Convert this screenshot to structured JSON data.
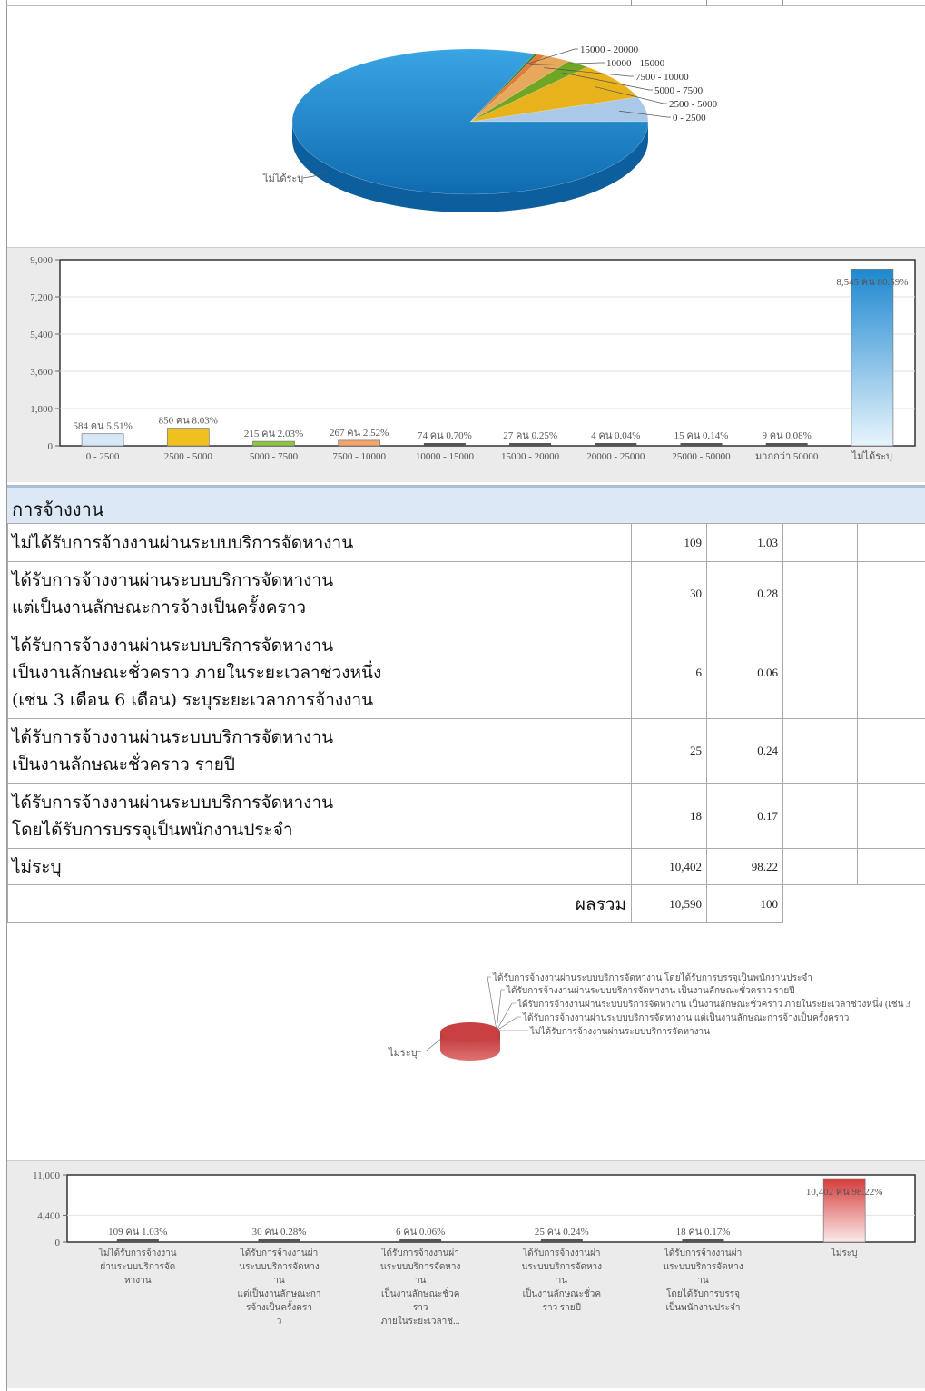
{
  "income_section": {
    "chart_data": [
      {
        "type": "pie",
        "labels": [
          "15000 - 20000",
          "10000 - 15000",
          "7500 - 10000",
          "5000 - 7500",
          "2500 - 5000",
          "0 - 2500",
          "ไม่ได้ระบุ"
        ],
        "values": [
          0.25,
          0.7,
          2.52,
          2.03,
          8.03,
          5.51,
          80.59
        ],
        "colors": [
          "#4f7a28",
          "#e07b39",
          "#e8a85b",
          "#6fa623",
          "#e7b21b",
          "#aac8e8",
          "#2a8fd0"
        ]
      },
      {
        "type": "bar",
        "categories": [
          "0 - 2500",
          "2500 - 5000",
          "5000 - 7500",
          "7500 - 10000",
          "10000 - 15000",
          "15000 - 20000",
          "20000 - 25000",
          "25000 - 50000",
          "มากกว่า 50000",
          "ไม่ได้ระบุ"
        ],
        "values": [
          584,
          850,
          215,
          267,
          74,
          27,
          4,
          15,
          9,
          8545
        ],
        "data_labels": [
          "584 คน 5.51%",
          "850 คน 8.03%",
          "215 คน 2.03%",
          "267 คน 2.52%",
          "74 คน 0.70%",
          "27 คน 0.25%",
          "4 คน 0.04%",
          "15 คน 0.14%",
          "9 คน 0.08%",
          "8,545 คน 80.59%"
        ],
        "colors": [
          "#d6e8f8",
          "#f0c020",
          "#8cc63f",
          "#f4a46a",
          "#555",
          "#555",
          "#555",
          "#555",
          "#555",
          "#1e88d0"
        ],
        "yticks": [
          "0",
          "1,800",
          "3,600",
          "5,400",
          "7,200",
          "9,000"
        ],
        "ylim": [
          0,
          9000
        ]
      }
    ]
  },
  "employment_section": {
    "header": "การจ้างงาน",
    "rows": [
      {
        "label": "ไม่ได้รับการจ้างงานผ่านระบบบริการจัดหางาน",
        "count": "109",
        "percent": "1.03"
      },
      {
        "label": "ได้รับการจ้างงานผ่านระบบบริการจัดหางาน\nแต่เป็นงานลักษณะการจ้างเป็นครั้งคราว",
        "count": "30",
        "percent": "0.28"
      },
      {
        "label": "ได้รับการจ้างงานผ่านระบบบริการจัดหางาน\nเป็นงานลักษณะชั่วคราว ภายในระยะเวลาช่วงหนึ่ง\n(เช่น 3 เดือน 6 เดือน) ระบุระยะเวลาการจ้างงาน",
        "count": "6",
        "percent": "0.06"
      },
      {
        "label": "ได้รับการจ้างงานผ่านระบบบริการจัดหางาน\nเป็นงานลักษณะชั่วคราว รายปี",
        "count": "25",
        "percent": "0.24"
      },
      {
        "label": "ได้รับการจ้างงานผ่านระบบบริการจัดหางาน\nโดยได้รับการบรรจุเป็นพนักงานประจำ",
        "count": "18",
        "percent": "0.17"
      },
      {
        "label": "ไม่ระบุ",
        "count": "10,402",
        "percent": "98.22"
      }
    ],
    "total": {
      "label": "ผลรวม",
      "count": "10,590",
      "percent": "100"
    },
    "chart_data": [
      {
        "type": "pie",
        "labels": [
          "ได้รับการจ้างงานผ่านระบบบริการจัดหางาน โดยได้รับการบรรจุเป็นพนักงานประจำ",
          "ได้รับการจ้างงานผ่านระบบบริการจัดหางาน เป็นงานลักษณะชั่วคราว รายปี",
          "ได้รับการจ้างงานผ่านระบบบริการจัดหางาน เป็นงานลักษณะชั่วคราว ภายในระยะเวลาช่วงหนึ่ง (เช่น 3",
          "ได้รับการจ้างงานผ่านระบบบริการจัดหางาน แต่เป็นงานลักษณะการจ้างเป็นครั้งคราว",
          "ไม่ได้รับการจ้างงานผ่านระบบบริการจัดหางาน",
          "ไม่ระบุ"
        ],
        "values": [
          0.17,
          0.24,
          0.06,
          0.28,
          1.03,
          98.22
        ],
        "colors": [
          "#c94444",
          "#c94444",
          "#c94444",
          "#c94444",
          "#c94444",
          "#c94444"
        ]
      },
      {
        "type": "bar",
        "categories": [
          "ไม่ได้รับการจ้างงาน\nผ่านระบบบริการจัด\nหางาน",
          "ได้รับการจ้างงานผ่า\nนระบบบริการจัดหาง\nาน\nแต่เป็นงานลักษณะกา\nรจ้างเป็นครั้งครา\nว",
          "ได้รับการจ้างงานผ่า\nนระบบบริการจัดหาง\nาน\nเป็นงานลักษณะชั่วค\nราว\nภายในระยะเวลาช่...",
          "ได้รับการจ้างงานผ่า\nนระบบบริการจัดหาง\nาน\nเป็นงานลักษณะชั่วค\nราว รายปี",
          "ได้รับการจ้างงานผ่า\nนระบบบริการจัดหาง\nาน\nโดยได้รับการบรรจุ\nเป็นพนักงานประจำ",
          "ไม่ระบุ"
        ],
        "values": [
          109,
          30,
          6,
          25,
          18,
          10402
        ],
        "data_labels": [
          "109 คน 1.03%",
          "30 คน 0.28%",
          "6 คน 0.06%",
          "25 คน 0.24%",
          "18 คน 0.17%",
          "10,402 คน 98.22%"
        ],
        "colors": [
          "#555",
          "#555",
          "#555",
          "#555",
          "#555",
          "#d43c3c"
        ],
        "yticks": [
          "0",
          "4,400",
          "11,000"
        ],
        "ylim": [
          0,
          11000
        ]
      }
    ]
  }
}
